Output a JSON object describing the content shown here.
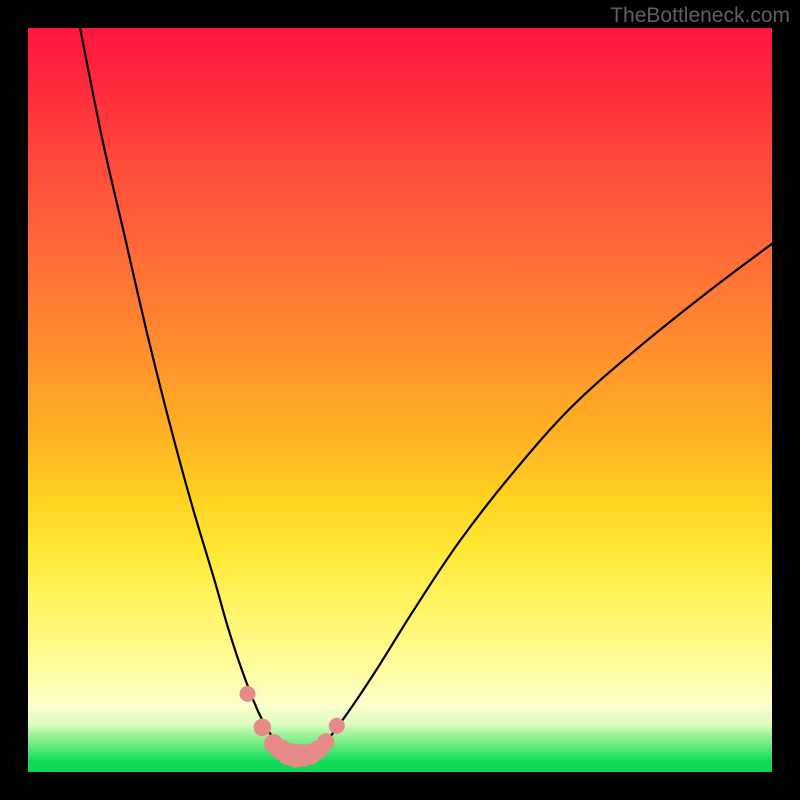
{
  "watermark": "TheBottleneck.com",
  "chart_data": {
    "type": "line",
    "title": "",
    "xlabel": "",
    "ylabel": "",
    "xlim": [
      0,
      100
    ],
    "ylim": [
      0,
      100
    ],
    "grid": false,
    "series": [
      {
        "name": "bottleneck-curve",
        "x": [
          7,
          10,
          13,
          16,
          19,
          22,
          25,
          27,
          29,
          31,
          33,
          35,
          36.5,
          38,
          40,
          43,
          47,
          52,
          58,
          65,
          73,
          82,
          92,
          100
        ],
        "y": [
          100,
          85,
          72,
          59,
          47,
          36,
          26,
          19,
          13,
          8,
          4.5,
          2.5,
          2,
          2.3,
          4,
          8,
          14,
          22,
          31,
          40,
          49,
          57,
          65,
          71
        ]
      }
    ],
    "valley_markers": {
      "name": "valley-dots",
      "x": [
        29.5,
        31.5,
        33,
        34,
        35,
        36,
        37,
        38,
        39,
        40,
        41.5
      ],
      "y": [
        10.5,
        6,
        3.8,
        3,
        2.4,
        2.2,
        2.2,
        2.4,
        3,
        4,
        6.2
      ]
    },
    "colors": {
      "curve": "#000000",
      "marker_fill": "#e98a8a",
      "marker_stroke": "#d87676",
      "gradient_top": "#ff163e",
      "gradient_bottom": "#0bd656"
    }
  }
}
